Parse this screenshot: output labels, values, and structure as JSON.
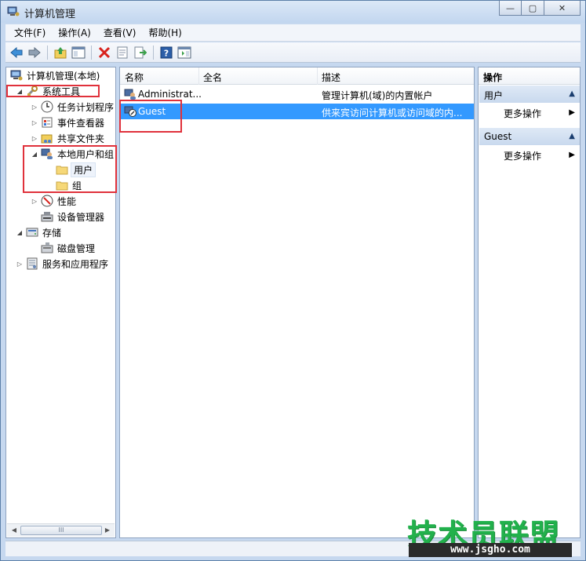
{
  "window": {
    "title": "计算机管理",
    "controls": {
      "minimize": "—",
      "maximize": "▢",
      "close": "✕"
    }
  },
  "menu": [
    "文件(F)",
    "操作(A)",
    "查看(V)",
    "帮助(H)"
  ],
  "toolbar": [
    "back-icon",
    "forward-icon",
    "up-icon",
    "show-hide-tree-icon",
    "delete-icon",
    "properties-icon",
    "export-icon",
    "help-icon",
    "show-action-pane-icon"
  ],
  "tree": {
    "root": "计算机管理(本地)",
    "items": [
      {
        "label": "系统工具",
        "expander": "◢"
      },
      {
        "label": "任务计划程序",
        "expander": "▷"
      },
      {
        "label": "事件查看器",
        "expander": "▷"
      },
      {
        "label": "共享文件夹",
        "expander": "▷"
      },
      {
        "label": "本地用户和组",
        "expander": "◢"
      },
      {
        "label": "用户",
        "expander": ""
      },
      {
        "label": "组",
        "expander": ""
      },
      {
        "label": "性能",
        "expander": "▷"
      },
      {
        "label": "设备管理器",
        "expander": ""
      },
      {
        "label": "存储",
        "expander": "◢"
      },
      {
        "label": "磁盘管理",
        "expander": ""
      },
      {
        "label": "服务和应用程序",
        "expander": "▷"
      }
    ],
    "scroll_thumb": "III"
  },
  "list": {
    "columns": [
      "名称",
      "全名",
      "描述"
    ],
    "rows": [
      {
        "name": "Administrat...",
        "fullname": "",
        "desc": "管理计算机(域)的内置帐户"
      },
      {
        "name": "Guest",
        "fullname": "",
        "desc": "供来宾访问计算机或访问域的内..."
      }
    ]
  },
  "actions": {
    "title": "操作",
    "sections": [
      {
        "label": "用户",
        "item": "更多操作"
      },
      {
        "label": "Guest",
        "item": "更多操作"
      }
    ],
    "collapse_arrow": "▲",
    "more_arrow": "▶"
  },
  "watermark": {
    "brand": "技术员联盟",
    "url": "www.jsgho.com"
  },
  "colors": {
    "selection": "#3399ff",
    "highlight_box": "#e0313b",
    "watermark": "#22b14c"
  }
}
